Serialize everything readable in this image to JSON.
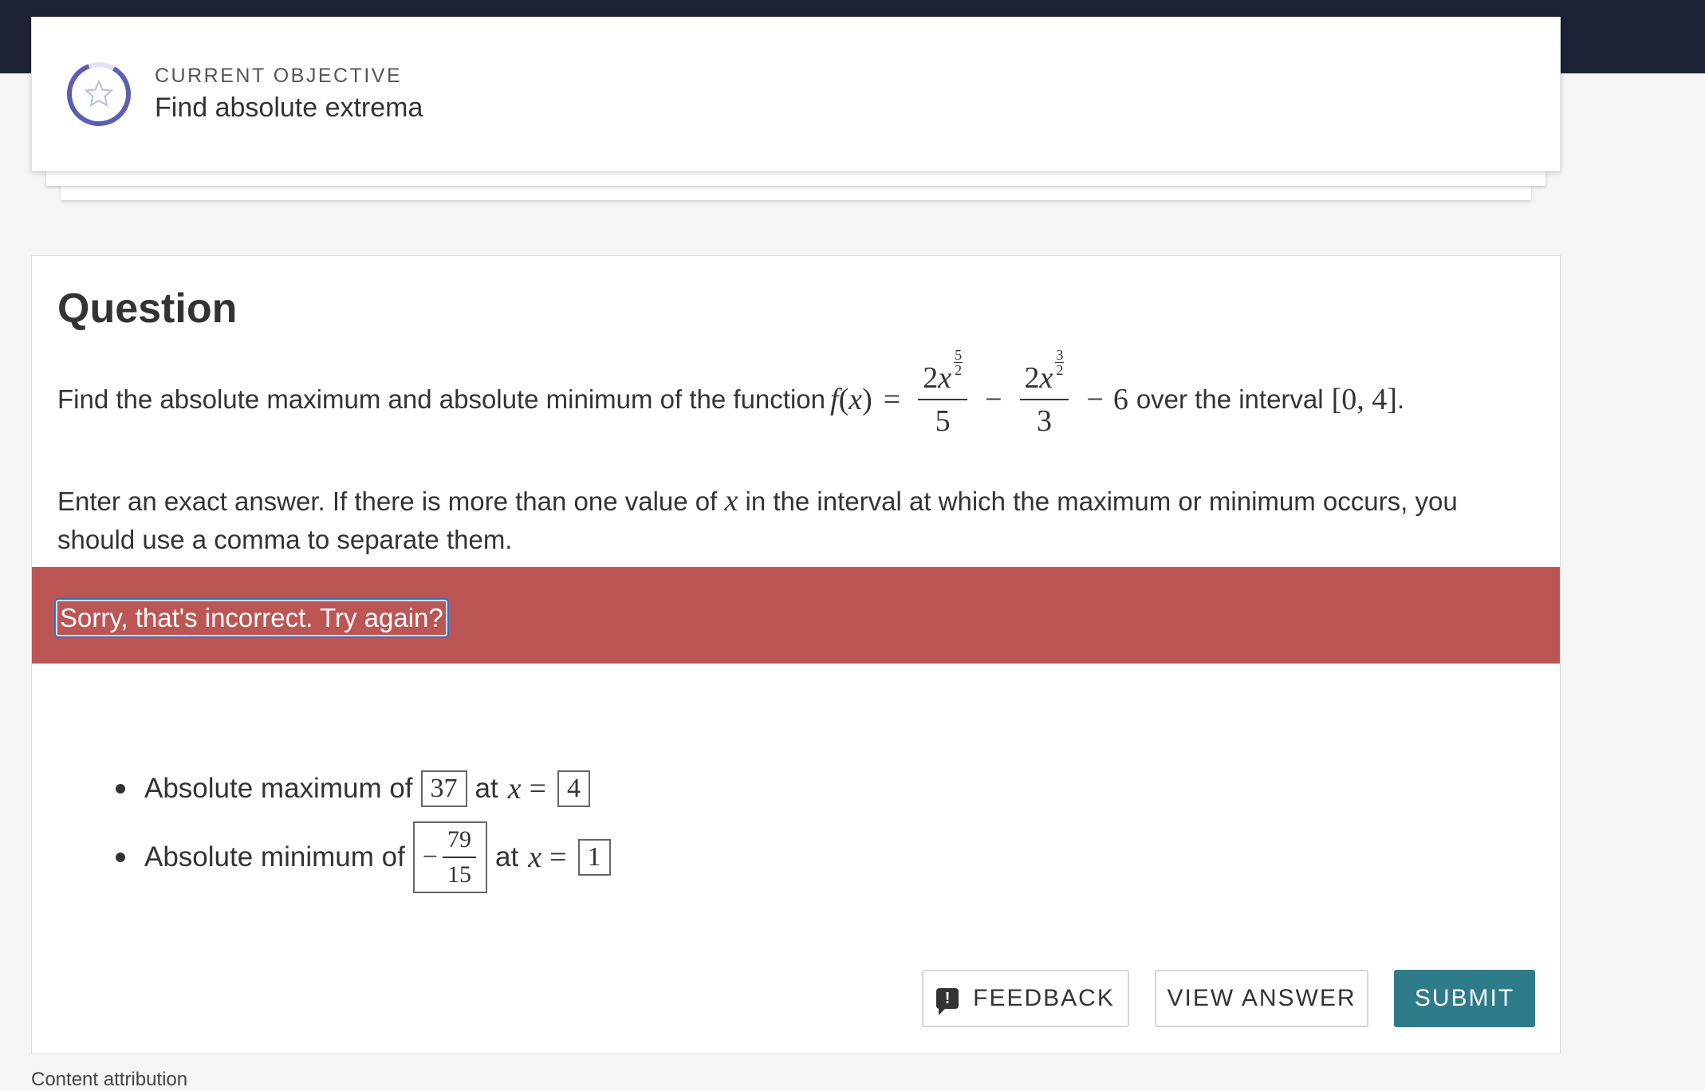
{
  "objective": {
    "kicker": "CURRENT OBJECTIVE",
    "title": "Find absolute extrema",
    "icon": "star-icon",
    "ring_color": "#5b5fb0"
  },
  "question": {
    "heading": "Question",
    "line1_prefix": "Find the absolute maximum and absolute minimum of the function",
    "func": "f",
    "var": "x",
    "eq": "=",
    "term1_coef": "2",
    "term1_var": "x",
    "term1_exp_num": "5",
    "term1_exp_den": "2",
    "term1_den": "5",
    "minus": "−",
    "term2_coef": "2",
    "term2_var": "x",
    "term2_exp_num": "3",
    "term2_exp_den": "2",
    "term2_den": "3",
    "const": "6",
    "line1_mid": "over the interval",
    "interval": "[0, 4]",
    "period": ".",
    "para2_a": "Enter an exact answer. If there is more than one value of",
    "para2_var": "x",
    "para2_b": "in the interval at which the maximum or minimum occurs, you should use a comma to separate them."
  },
  "feedback": {
    "message": "Sorry, that's incorrect. Try again?",
    "color": "#bc5654"
  },
  "answers": {
    "max_label": "Absolute maximum of",
    "max_value": "37",
    "max_at": "at",
    "max_x": "x",
    "max_eq": "=",
    "max_x_value": "4",
    "min_label": "Absolute minimum of",
    "min_sign": "−",
    "min_num": "79",
    "min_den": "15",
    "min_at": "at",
    "min_x": "x",
    "min_eq": "=",
    "min_x_value": "1"
  },
  "buttons": {
    "feedback": "FEEDBACK",
    "view_answer": "VIEW ANSWER",
    "submit": "SUBMIT",
    "submit_color": "#2e7b8a"
  },
  "footer": {
    "attribution": "Content attribution"
  }
}
